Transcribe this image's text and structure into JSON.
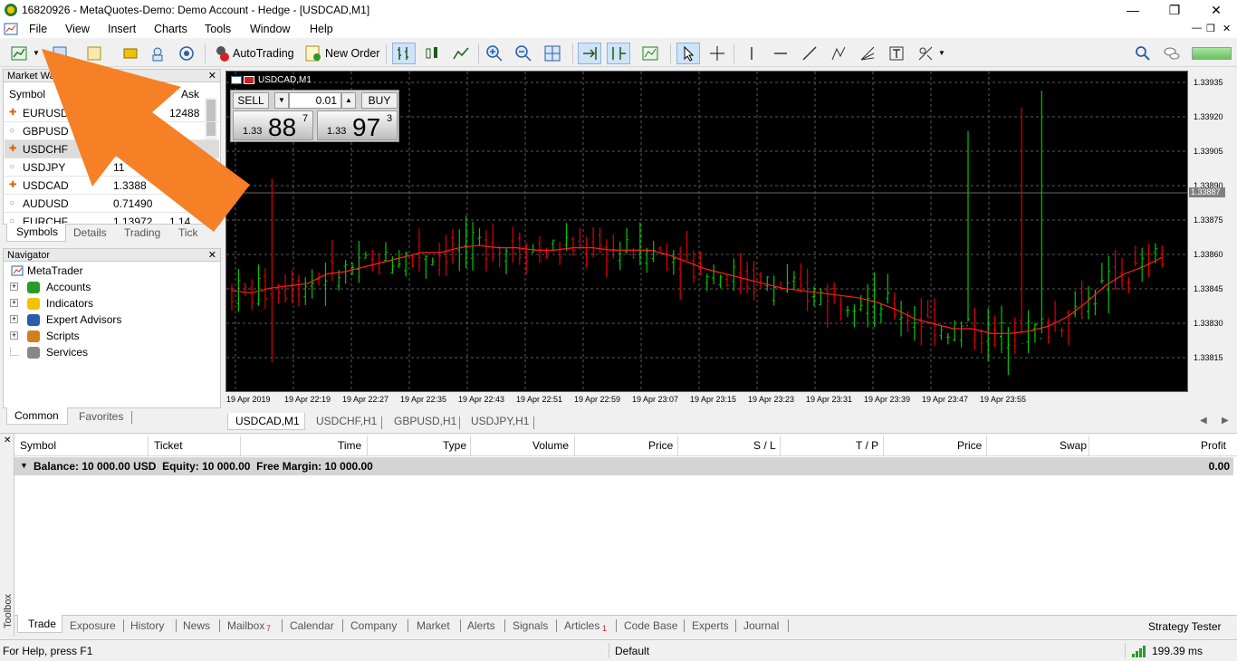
{
  "window": {
    "title": "16820926 - MetaQuotes-Demo: Demo Account - Hedge - [USDCAD,M1]"
  },
  "menu": [
    "File",
    "View",
    "Insert",
    "Charts",
    "Tools",
    "Window",
    "Help"
  ],
  "toolbar": {
    "autotrading": "AutoTrading",
    "new_order": "New Order"
  },
  "market_watch": {
    "title": "Market Wa",
    "col_symbol": "Symbol",
    "col_ask": "Ask",
    "rows": [
      {
        "symbol": "EURUSD",
        "bid": "",
        "ask": "12488"
      },
      {
        "symbol": "GBPUSD",
        "bid": "",
        "ask": ""
      },
      {
        "symbol": "USDCHF",
        "bid": "",
        "ask": ""
      },
      {
        "symbol": "USDJPY",
        "bid": "11",
        "ask": ""
      },
      {
        "symbol": "USDCAD",
        "bid": "1.3388",
        "ask": ""
      },
      {
        "symbol": "AUDUSD",
        "bid": "0.71490",
        "ask": ""
      },
      {
        "symbol": "EURCHF",
        "bid": "1.13972",
        "ask": "1.14"
      }
    ],
    "tabs": [
      "Symbols",
      "Details",
      "Trading",
      "Tick"
    ]
  },
  "navigator": {
    "title": "Navigator",
    "root": "MetaTrader",
    "items": [
      "Accounts",
      "Indicators",
      "Expert Advisors",
      "Scripts",
      "Services"
    ],
    "tabs": [
      "Common",
      "Favorites"
    ]
  },
  "chart": {
    "label": "USDCAD,M1",
    "sell_label": "SELL",
    "buy_label": "BUY",
    "lot": "0.01",
    "sell_price": {
      "prefix": "1.33",
      "big": "88",
      "sup": "7"
    },
    "buy_price": {
      "prefix": "1.33",
      "big": "97",
      "sup": "3"
    },
    "price_labels": [
      "1.33935",
      "1.33920",
      "1.33905",
      "1.33890",
      "1.33875",
      "1.33860",
      "1.33845",
      "1.33830",
      "1.33815"
    ],
    "current_price": "1.33887",
    "time_labels": [
      "19 Apr 2019",
      "19 Apr 22:19",
      "19 Apr 22:27",
      "19 Apr 22:35",
      "19 Apr 22:43",
      "19 Apr 22:51",
      "19 Apr 22:59",
      "19 Apr 23:07",
      "19 Apr 23:15",
      "19 Apr 23:23",
      "19 Apr 23:31",
      "19 Apr 23:39",
      "19 Apr 23:47",
      "19 Apr 23:55"
    ],
    "colors": {
      "bull": "#00c800",
      "bear": "#e00000",
      "ma": "#ff2020",
      "grid": "#5a5a5a"
    }
  },
  "chart_data": {
    "type": "line",
    "series": [
      {
        "values": [
          1.33848,
          1.33847,
          1.33849,
          1.3385,
          1.33851,
          1.33855,
          1.33856,
          1.33858,
          1.3386,
          1.33862,
          1.33864,
          1.33864,
          1.33866,
          1.33867,
          1.33866,
          1.33866,
          1.33865,
          1.33865,
          1.33866,
          1.33866,
          1.33865,
          1.33865,
          1.33865,
          1.33863,
          1.3386,
          1.33857,
          1.33855,
          1.33853,
          1.33851,
          1.33849,
          1.33848,
          1.33847,
          1.33846,
          1.33845,
          1.33843,
          1.3384,
          1.33836,
          1.33834,
          1.33832,
          1.33832,
          1.3383,
          1.3383,
          1.33831,
          1.33833,
          1.33837,
          1.33843,
          1.3385,
          1.33855,
          1.33858,
          1.33862
        ]
      }
    ],
    "ylim": [
      1.33805,
      1.3394
    ]
  },
  "chart_tabs": [
    "USDCAD,M1",
    "USDCHF,H1",
    "GBPUSD,H1",
    "USDJPY,H1"
  ],
  "terminal": {
    "columns": [
      "Symbol",
      "Ticket",
      "Time",
      "Type",
      "Volume",
      "Price",
      "S / L",
      "T / P",
      "Price",
      "Swap",
      "Profit"
    ],
    "balance_row": "Balance: 10 000.00 USD  Equity: 10 000.00  Free Margin: 10 000.00",
    "profit": "0.00",
    "side_label": "Toolbox",
    "tabs": [
      "Trade",
      "Exposure",
      "History",
      "News",
      "Mailbox",
      "Calendar",
      "Company",
      "Market",
      "Alerts",
      "Signals",
      "Articles",
      "Code Base",
      "Experts",
      "Journal"
    ],
    "mailbox_badge": "7",
    "articles_badge": "1",
    "strategy_tester": "Strategy Tester"
  },
  "status": {
    "help": "For Help, press F1",
    "profile": "Default",
    "ping": "199.39 ms"
  }
}
